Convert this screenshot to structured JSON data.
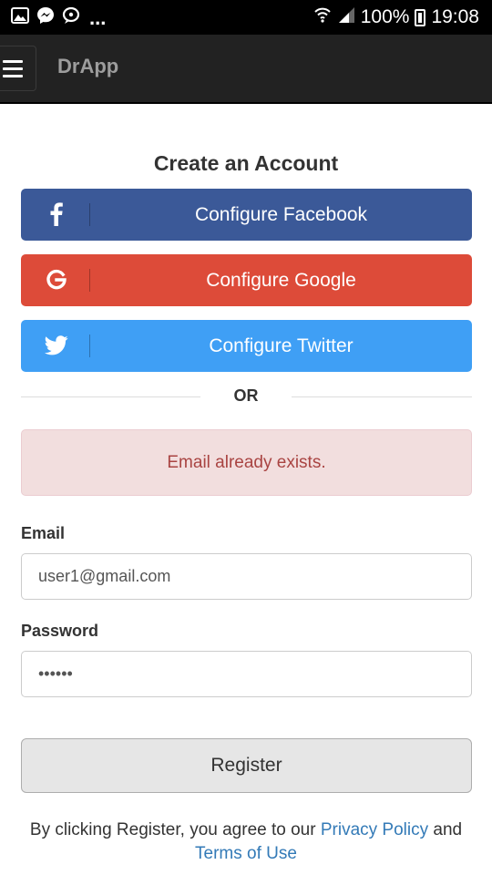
{
  "status_bar": {
    "notification_icons": [
      "image-icon",
      "messenger-icon",
      "chat-icon"
    ],
    "overflow": "...",
    "battery": "100%",
    "time": "19:08"
  },
  "app_bar": {
    "title": "DrApp",
    "menu_icon": "hamburger-icon"
  },
  "form": {
    "heading": "Create an Account",
    "social_buttons": [
      {
        "label": "Configure Facebook",
        "icon": "facebook-icon",
        "color": "#3b5998"
      },
      {
        "label": "Configure Google",
        "icon": "google-icon",
        "color": "#dd4b39"
      },
      {
        "label": "Configure Twitter",
        "icon": "twitter-icon",
        "color": "#3f9ff5"
      }
    ],
    "or_text": "OR",
    "alert": "Email already exists.",
    "email_label": "Email",
    "email_value": "user1@gmail.com",
    "password_label": "Password",
    "password_value": "••••••",
    "register_label": "Register",
    "terms_prefix": "By clicking Register, you agree to our",
    "privacy_link": "Privacy Policy",
    "terms_and": "and",
    "terms_link": "Terms of Use"
  },
  "colors": {
    "alert_bg": "#f2dede",
    "alert_text": "#a94442",
    "link": "#337ab7"
  }
}
